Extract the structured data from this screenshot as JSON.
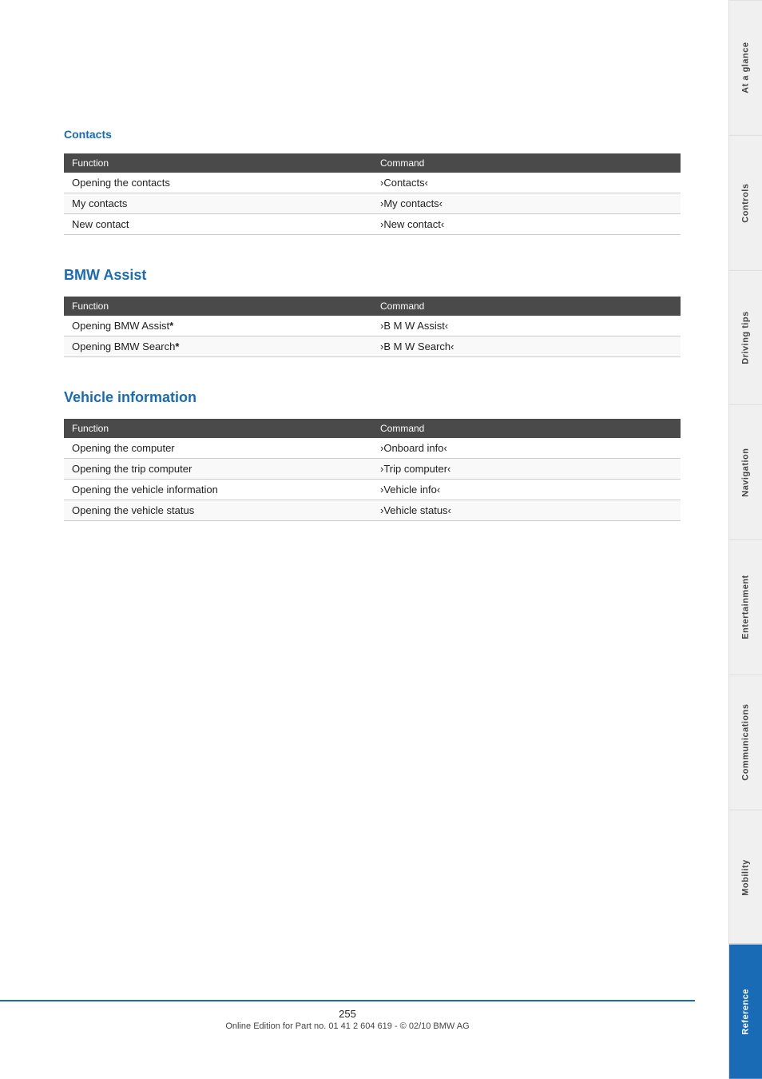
{
  "contacts": {
    "title": "Contacts",
    "table": {
      "headers": [
        "Function",
        "Command"
      ],
      "rows": [
        [
          "Opening the contacts",
          "›Contacts‹"
        ],
        [
          "My contacts",
          "›My contacts‹"
        ],
        [
          "New contact",
          "›New contact‹"
        ]
      ]
    }
  },
  "bmw_assist": {
    "title": "BMW Assist",
    "table": {
      "headers": [
        "Function",
        "Command"
      ],
      "rows": [
        [
          "Opening BMW Assist*",
          "›B M W Assist‹"
        ],
        [
          "Opening BMW Search*",
          "›B M W Search‹"
        ]
      ]
    }
  },
  "vehicle_information": {
    "title": "Vehicle information",
    "table": {
      "headers": [
        "Function",
        "Command"
      ],
      "rows": [
        [
          "Opening the computer",
          "›Onboard info‹"
        ],
        [
          "Opening the trip computer",
          "›Trip computer‹"
        ],
        [
          "Opening the vehicle information",
          "›Vehicle info‹"
        ],
        [
          "Opening the vehicle status",
          "›Vehicle status‹"
        ]
      ]
    }
  },
  "footer": {
    "page_number": "255",
    "edition_text": "Online Edition for Part no. 01 41 2 604 619 - © 02/10 BMW AG"
  },
  "sidebar": {
    "tabs": [
      {
        "label": "At a glance",
        "active": false
      },
      {
        "label": "Controls",
        "active": false
      },
      {
        "label": "Driving tips",
        "active": false
      },
      {
        "label": "Navigation",
        "active": false
      },
      {
        "label": "Entertainment",
        "active": false
      },
      {
        "label": "Communications",
        "active": false
      },
      {
        "label": "Mobility",
        "active": false
      },
      {
        "label": "Reference",
        "active": true
      }
    ]
  }
}
